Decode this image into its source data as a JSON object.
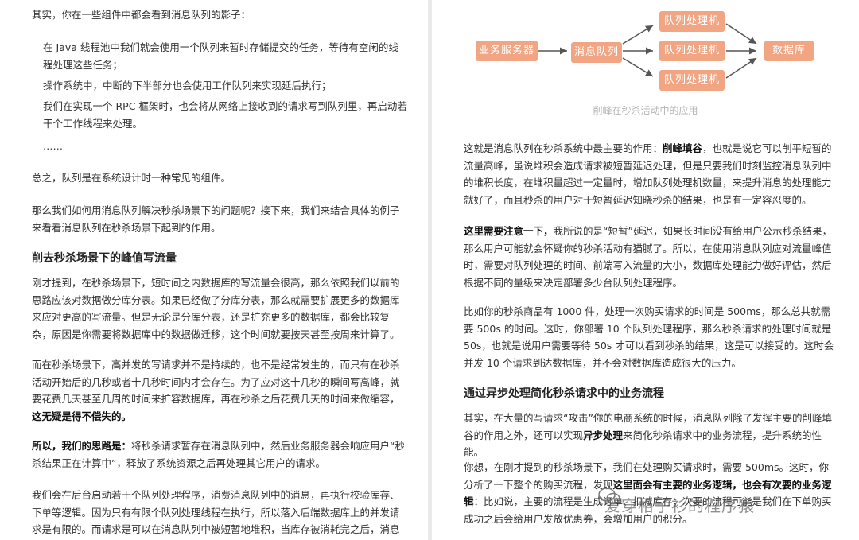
{
  "left": {
    "intro": "其实，你在一些组件中都会看到消息队列的影子：",
    "bullets": [
      "在 Java 线程池中我们就会使用一个队列来暂时存储提交的任务，等待有空闲的线程处理这些任务；",
      "操作系统中，中断的下半部分也会使用工作队列来实现延后执行；",
      "我们在实现一个 RPC 框架时，也会将从网络上接收到的请求写到队列里，再启动若干个工作线程来处理。",
      "……"
    ],
    "summary": "总之，队列是在系统设计时一种常见的组件。",
    "question": "那么我们如何用消息队列解决秒杀场景下的问题呢？接下来，我们来结合具体的例子来看看消息队列在秒杀场景下起到的作用。",
    "heading": "削去秒杀场景下的峰值写流量",
    "para1": "刚才提到，在秒杀场景下，短时间之内数据库的写流量会很高，那么依照我们以前的思路应该对数据做分库分表。如果已经做了分库分表，那么就需要扩展更多的数据库来应对更高的写流量。但是无论是分库分表，还是扩充更多的数据库，都会比较复杂，原因是你需要将数据库中的数据做迁移，这个时间就要按天甚至按周来计算了。",
    "para2_a": "而在秒杀场景下，高并发的写请求并不是持续的，也不是经常发生的，而只有在秒杀活动开始后的几秒或者十几秒时间内才会存在。为了应对这十几秒的瞬间写高峰，就要花费几天甚至几周的时间来扩容数据库，再在秒杀之后花费几天的时间来做缩容，",
    "para2_b": "这无疑是得不偿失的。",
    "para3_a": "所以，我们的思路是：",
    "para3_b": "将秒杀请求暂存在消息队列中，然后业务服务器会响应用户“秒杀结果正在计算中”，释放了系统资源之后再处理其它用户的请求。",
    "para4": "我们会在后台启动若干个队列处理程序，消费消息队列中的消息，再执行校验库存、下单等逻辑。因为只有有限个队列处理线程在执行，所以落入后端数据库上的并发请求是有限的。而请求是可以在消息队列中被短暂地堆积，当库存被消耗完之后，消息队列中堆积的请求就"
  },
  "diagram": {
    "service": "业务服务器",
    "queue": "消息队列",
    "worker1": "队列处理机",
    "worker2": "队列处理机",
    "worker3": "队列处理机",
    "db": "数据库",
    "caption": "削峰在秒杀活动中的应用",
    "box_color": "#f2a582"
  },
  "right": {
    "para1_a": "这就是消息队列在秒杀系统中最主要的作用：",
    "para1_b": "削峰填谷",
    "para1_c": "，也就是说它可以削平短暂的流量高峰，虽说堆积会造成请求被短暂延迟处理，但是只要我们时刻监控消息队列中的堆积长度，在堆积量超过一定量时，增加队列处理机数量，来提升消息的处理能力就好了，而且秒杀的用户对于短暂延迟知晓秒杀的结果，也是有一定容忍度的。",
    "para2_a": "这里需要注意一下，",
    "para2_b": "我所说的是“短暂”延迟，如果长时间没有给用户公示秒杀结果，那么用户可能就会怀疑你的秒杀活动有猫腻了。所以，在使用消息队列应对流量峰值时，需要对队列处理的时间、前端写入流量的大小，数据库处理能力做好评估，然后根据不同的量级来决定部署多少台队列处理程序。",
    "para3": "比如你的秒杀商品有 1000 件，处理一次购买请求的时间是 500ms，那么总共就需要 500s 的时间。这时，你部署 10 个队列处理程序，那么秒杀请求的处理时间就是 50s，也就是说用户需要等待 50s 才可以看到秒杀的结果，这是可以接受的。这时会并发 10 个请求到达数据库，并不会对数据库造成很大的压力。",
    "heading": "通过异步处理简化秒杀请求中的业务流程",
    "para4_a": "其实，在大量的写请求“攻击”你的电商系统的时候，消息队列除了发挥主要的削峰填谷的作用之外，还可以实现",
    "para4_b": "异步处理",
    "para4_c": "来简化秒杀请求中的业务流程，提升系统的性能。",
    "para5_a": "你想，在刚才提到的秒杀场景下，我们在处理购买请求时，需要 500ms。这时，你分析了一下整个的购买流程，发现",
    "para5_b": "这里面会有主要的业务逻辑，也会有次要的业务逻辑",
    "para5_c": "：比如说，主要的流程是生成订单、扣减库存；次要的流程可能是我们在下单购买成功之后会给用户发放优惠券，会增加用户的积分。"
  },
  "watermark": "爱穿格子衫的程序猿"
}
